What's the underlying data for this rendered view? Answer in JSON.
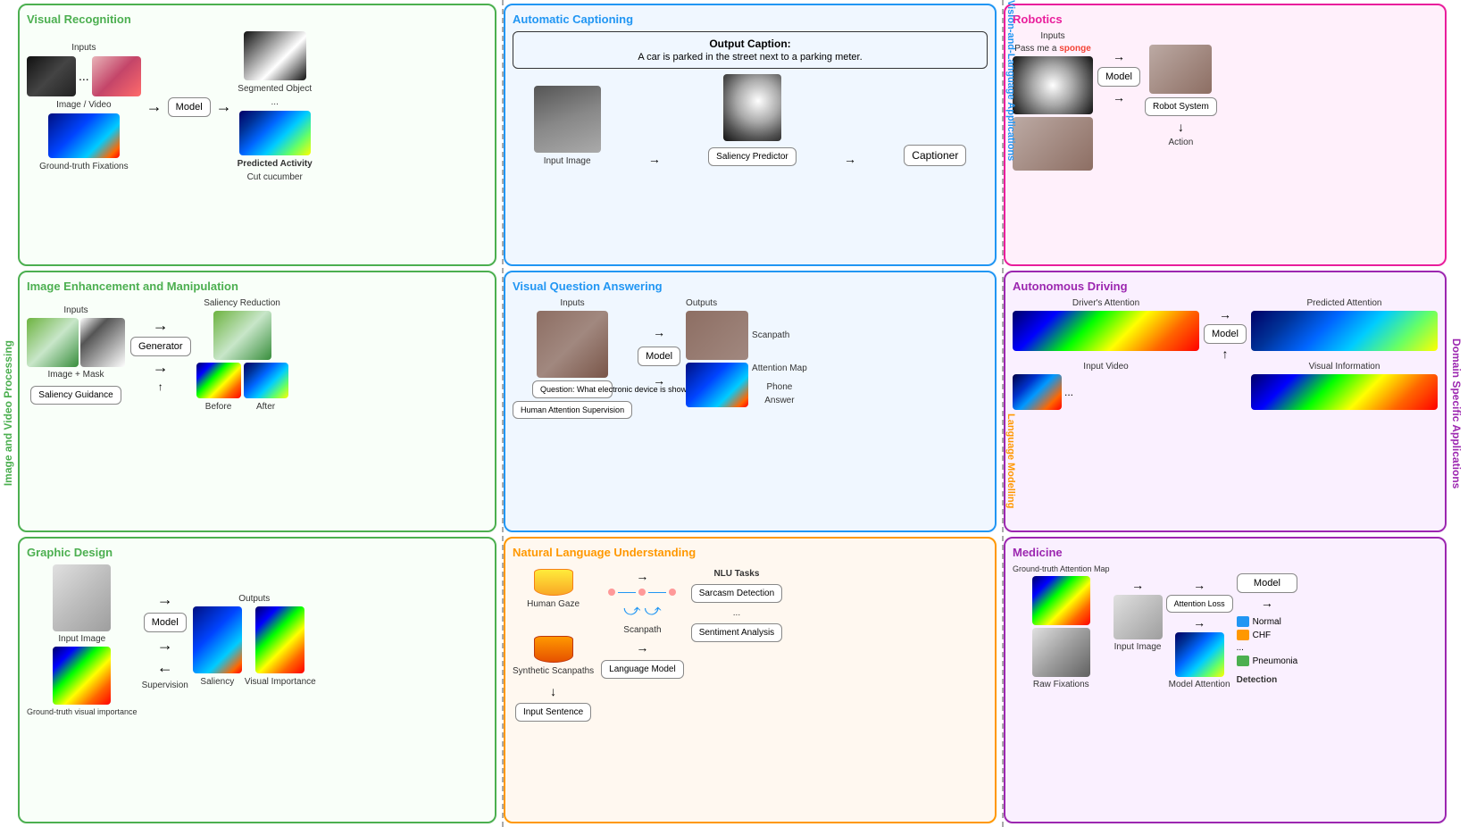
{
  "sections": {
    "left_label": "Image and Video Processing",
    "mid_label_top": "Vision-and-Language Applications",
    "mid_label_bot": "Language Modelling",
    "right_label": "Domain Specific Applications"
  },
  "visual_recognition": {
    "title": "Visual Recognition",
    "inputs_label": "Inputs",
    "image_video_label": "Image / Video",
    "model_label": "Model",
    "segmented_object_label": "Segmented Object",
    "dots": "...",
    "ground_truth_label": "Ground-truth Fixations",
    "predicted_label": "Predicted Activity",
    "predicted_sub": "Cut cucumber"
  },
  "image_enhancement": {
    "title": "Image Enhancement and Manipulation",
    "inputs_label": "Inputs",
    "image_mask_label": "Image + Mask",
    "generator_label": "Generator",
    "saliency_reduction_label": "Saliency Reduction",
    "saliency_guidance_label": "Saliency Guidance",
    "before_label": "Before",
    "after_label": "After"
  },
  "graphic_design": {
    "title": "Graphic Design",
    "input_image_label": "Input Image",
    "model_label": "Model",
    "outputs_label": "Outputs",
    "saliency_label": "Saliency",
    "visual_importance_label": "Visual Importance",
    "ground_truth_label": "Ground-truth\nvisual importance",
    "supervision_label": "Supervision"
  },
  "auto_captioning": {
    "title": "Automatic Captioning",
    "output_caption_label": "Output Caption:",
    "caption_text": "A car is parked in the street\nnext to a parking meter.",
    "input_image_label": "Input Image",
    "saliency_predictor_label": "Saliency\nPredictor",
    "captioner_label": "Captioner"
  },
  "vqa": {
    "title": "Visual Question Answering",
    "inputs_label": "Inputs",
    "outputs_label": "Outputs",
    "question_label": "Question: What electronic\ndevice is shown?",
    "model_label": "Model",
    "scanpath_label": "Scanpath",
    "attention_map_label": "Attention\nMap",
    "human_attention_label": "Human Attention\nSupervision",
    "phone_label": "Phone",
    "answer_label": "Answer"
  },
  "nlu": {
    "title": "Natural Language Understanding",
    "human_gaze_label": "Human Gaze",
    "synthetic_scanpaths_label": "Synthetic\nScanpaths",
    "scanpath_label": "Scanpath",
    "nlu_tasks_label": "NLU Tasks",
    "sarcasm_label": "Sarcasm\nDetection",
    "dots": "...",
    "sentiment_label": "Sentiment\nAnalysis",
    "input_sentence_label": "Input Sentence",
    "language_model_label": "Language\nModel"
  },
  "robotics": {
    "title": "Robotics",
    "inputs_label": "Inputs",
    "pass_me_label": "Pass me a",
    "sponge_label": "sponge",
    "model_label": "Model",
    "robot_system_label": "Robot\nSystem",
    "action_label": "Action"
  },
  "autonomous_driving": {
    "title": "Autonomous Driving",
    "drivers_attention_label": "Driver's Attention",
    "predicted_attention_label": "Predicted Attention",
    "input_video_label": "Input Video",
    "visual_information_label": "Visual Information",
    "model_label": "Model",
    "dots": "..."
  },
  "medicine": {
    "title": "Medicine",
    "ground_truth_label": "Ground-truth\nAttention Map",
    "raw_fixations_label": "Raw\nFixations",
    "input_image_label": "Input Image",
    "attention_loss_label": "Attention\nLoss",
    "model_label": "Model",
    "model_attention_label": "Model Attention",
    "normal_label": "Normal",
    "chf_label": "CHF",
    "dots": "...",
    "pneumonia_label": "Pneumonia",
    "detection_label": "Detection"
  }
}
